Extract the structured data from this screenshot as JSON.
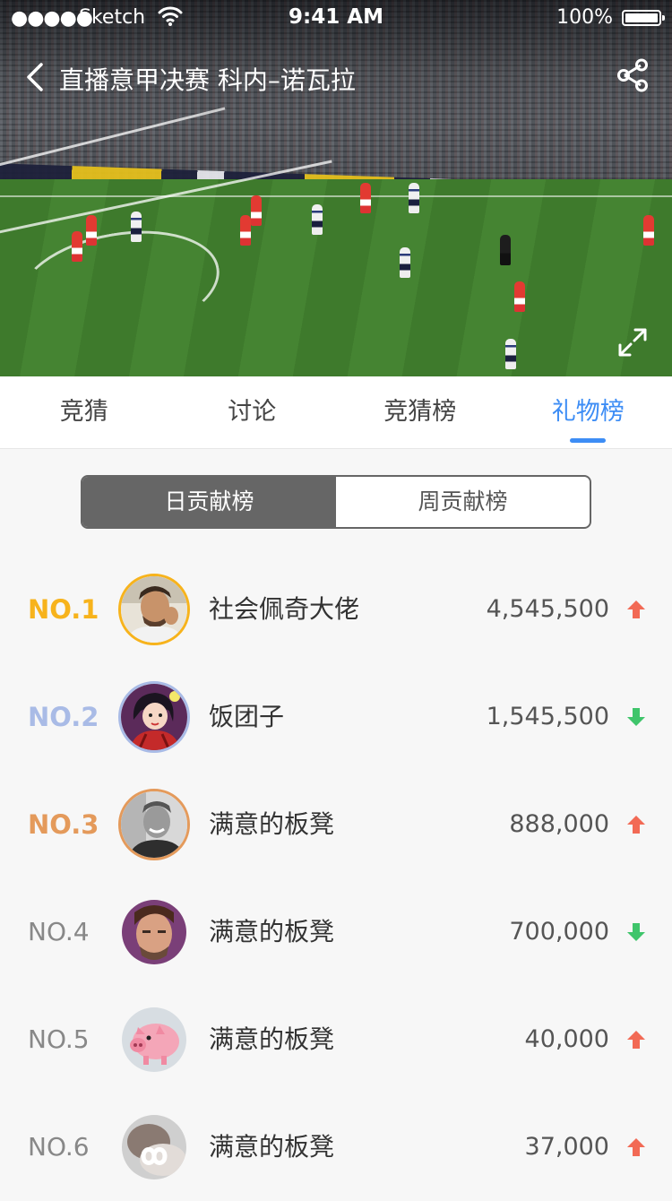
{
  "status_bar": {
    "signal": "●●●●●",
    "carrier": "Sketch",
    "time": "9:41 AM",
    "battery": "100%"
  },
  "header": {
    "title": "直播意甲决赛 科内–诺瓦拉"
  },
  "tabs": [
    {
      "label": "竞猜",
      "active": false
    },
    {
      "label": "讨论",
      "active": false
    },
    {
      "label": "竞猜榜",
      "active": false
    },
    {
      "label": "礼物榜",
      "active": true
    }
  ],
  "segment": {
    "options": [
      {
        "label": "日贡献榜",
        "active": true
      },
      {
        "label": "周贡献榜",
        "active": false
      }
    ]
  },
  "colors": {
    "accent": "#3d8df5",
    "rank1": "#f7b31c",
    "rank2": "#a9bbe6",
    "rank3": "#e49a5b",
    "up": "#f26a55",
    "down": "#3fc56b"
  },
  "ranking": [
    {
      "rank": "NO.1",
      "name": "社会佩奇大佬",
      "score": "4,545,500",
      "trend": "up",
      "avatar": "avatar-man-beard"
    },
    {
      "rank": "NO.2",
      "name": "饭团子",
      "score": "1,545,500",
      "trend": "down",
      "avatar": "avatar-cartoon-girl"
    },
    {
      "rank": "NO.3",
      "name": "满意的板凳",
      "score": "888,000",
      "trend": "up",
      "avatar": "avatar-man-smiling-bw"
    },
    {
      "rank": "NO.4",
      "name": "满意的板凳",
      "score": "700,000",
      "trend": "down",
      "avatar": "avatar-man-purple"
    },
    {
      "rank": "NO.5",
      "name": "满意的板凳",
      "score": "40,000",
      "trend": "up",
      "avatar": "avatar-pig"
    },
    {
      "rank": "NO.6",
      "name": "满意的板凳",
      "score": "37,000",
      "trend": "up",
      "avatar": "avatar-infinity"
    }
  ]
}
